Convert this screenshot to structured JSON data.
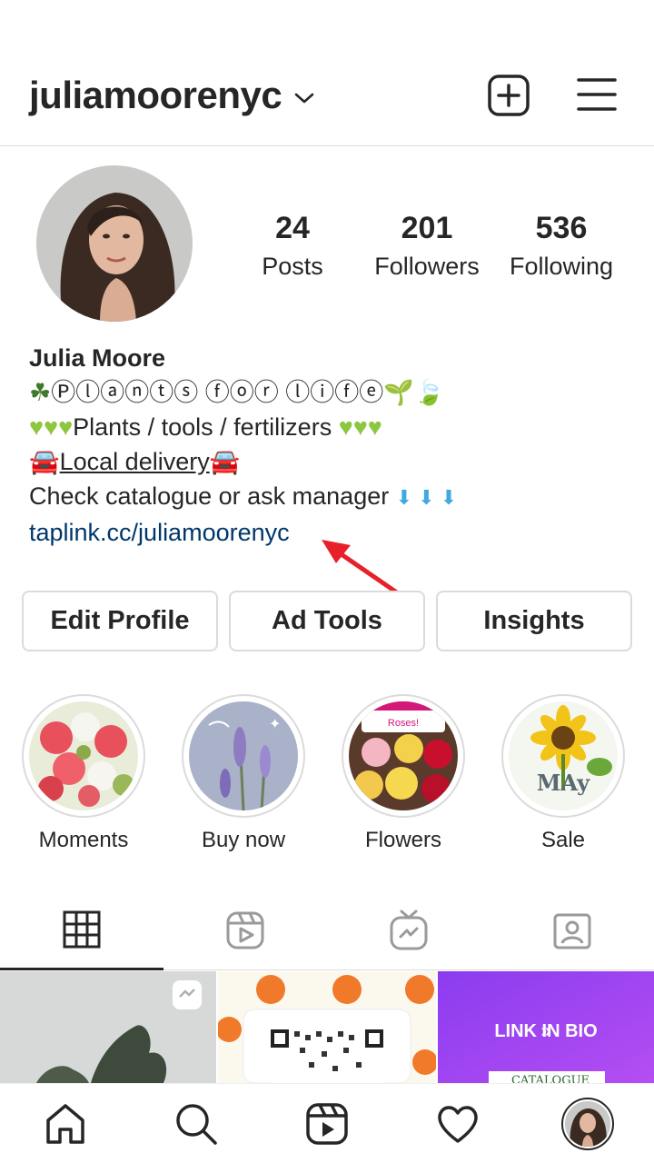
{
  "header": {
    "username": "juliamoorenyc"
  },
  "profile": {
    "stats": [
      {
        "value": "24",
        "label": "Posts"
      },
      {
        "value": "201",
        "label": "Followers"
      },
      {
        "value": "536",
        "label": "Following"
      }
    ],
    "name": "Julia Moore",
    "bio": {
      "line1_text": "Ⓟⓛⓐⓝⓣⓢ ⓕⓞⓡ ⓛⓘⓕⓔ",
      "line2_text": "Plants / tools / fertilizers",
      "line3_text": "Local delivery",
      "line4_text": "Check catalogue or ask manager",
      "link": "taplink.cc/juliamoorenyc"
    }
  },
  "buttons": {
    "edit": "Edit Profile",
    "ad_tools": "Ad Tools",
    "insights": "Insights"
  },
  "highlights": [
    {
      "label": "Moments"
    },
    {
      "label": "Buy now"
    },
    {
      "label": "Flowers"
    },
    {
      "label": "Sale"
    }
  ],
  "highlight_inner_text": {
    "flowers_caption": "Roses!",
    "sale_letters": "MAy"
  },
  "tabs": [
    "grid-icon",
    "reels-icon",
    "igtv-icon",
    "tagged-icon"
  ],
  "grid_posts": {
    "post3_text": "LINK IN BIO",
    "post3_sub": "CATALOGUE"
  },
  "bottom_nav": [
    "home-icon",
    "search-icon",
    "reels-icon",
    "heart-icon",
    "profile-avatar"
  ],
  "colors": {
    "link": "#00376b",
    "border": "#dbdbdb",
    "arrow": "#e8202a",
    "heart_green": "#8dc63f",
    "accent_purple": "#9b3cf0"
  }
}
